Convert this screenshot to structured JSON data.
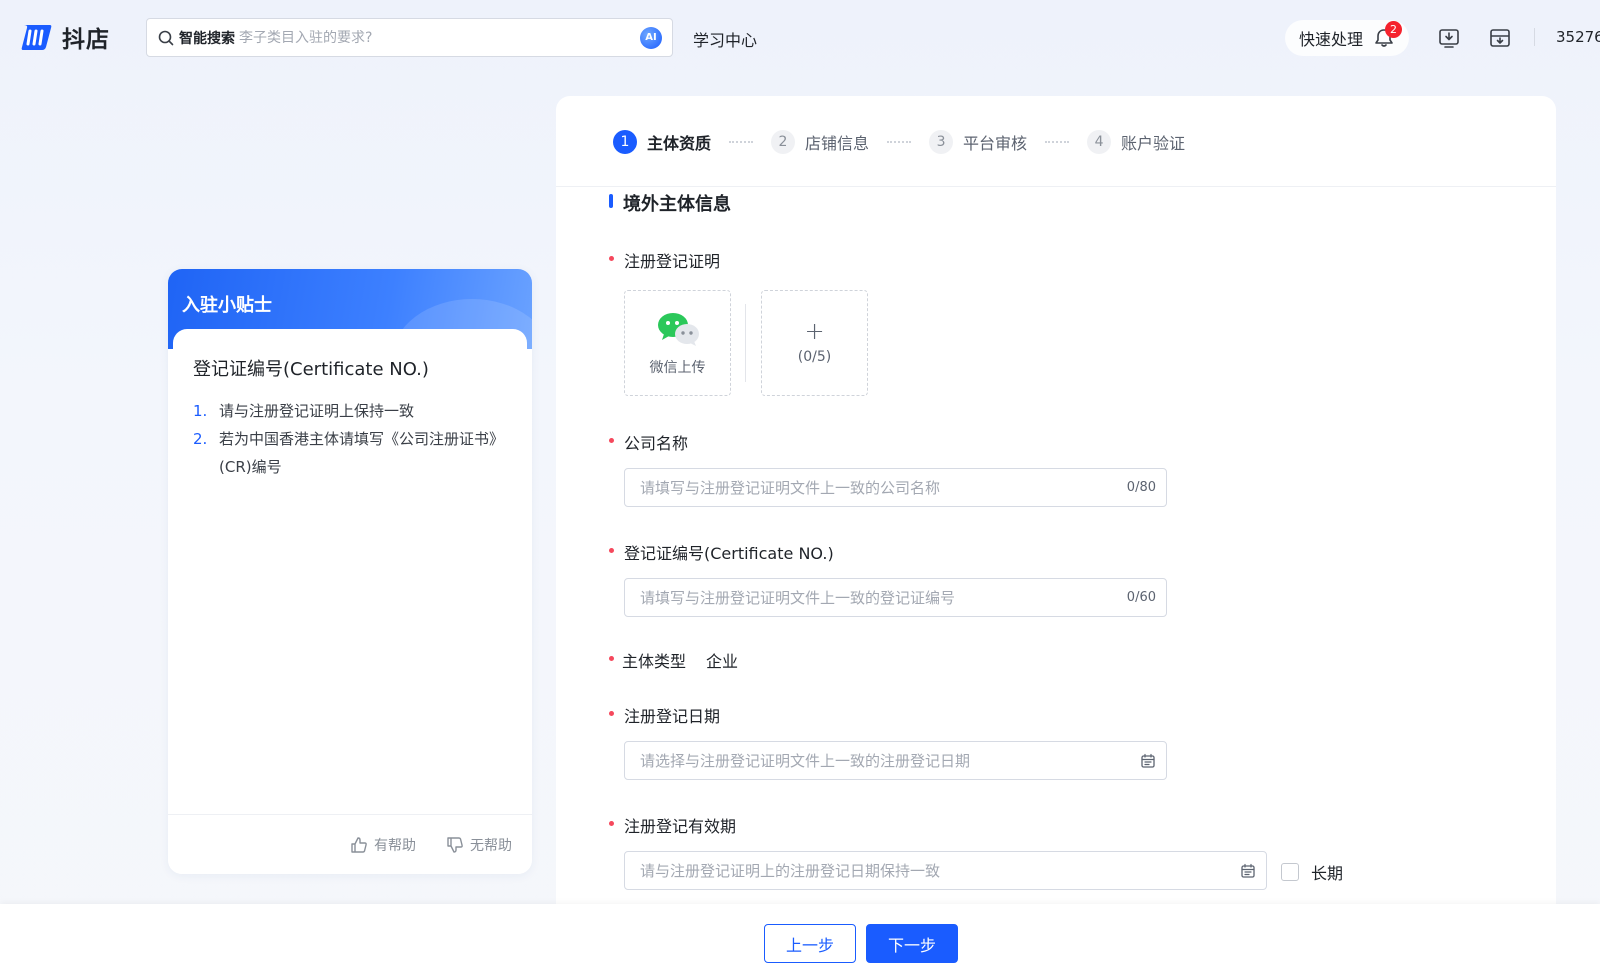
{
  "brand": {
    "name": "抖店",
    "accent": "#1a5cff"
  },
  "header": {
    "search_label": "智能搜索",
    "search_placeholder": "李子类目入驻的要求?",
    "ai_badge": "AI",
    "learning_center": "学习中心",
    "quick_process": "快速处理",
    "notification_count": "2",
    "account_id": "35276"
  },
  "tips": {
    "header": "入驻小贴士",
    "title": "登记证编号(Certificate NO.)",
    "items": [
      {
        "num": "1.",
        "text": "请与注册登记证明上保持一致"
      },
      {
        "num": "2.",
        "text": "若为中国香港主体请填写《公司注册证书》(CR)编号"
      }
    ],
    "helpful": "有帮助",
    "not_helpful": "无帮助"
  },
  "steps": [
    {
      "num": "1",
      "label": "主体资质",
      "active": true
    },
    {
      "num": "2",
      "label": "店铺信息",
      "active": false
    },
    {
      "num": "3",
      "label": "平台审核",
      "active": false
    },
    {
      "num": "4",
      "label": "账户验证",
      "active": false
    }
  ],
  "form": {
    "section_title": "境外主体信息",
    "registration_cert": {
      "label": "注册登记证明",
      "wechat_upload": "微信上传",
      "upload_count": "(0/5)"
    },
    "company_name": {
      "label": "公司名称",
      "placeholder": "请填写与注册登记证明文件上一致的公司名称",
      "counter": "0/80"
    },
    "certificate_no": {
      "label": "登记证编号(Certificate NO.)",
      "placeholder": "请填写与注册登记证明文件上一致的登记证编号",
      "counter": "0/60"
    },
    "entity_type": {
      "label": "主体类型",
      "value": "企业"
    },
    "registration_date": {
      "label": "注册登记日期",
      "placeholder": "请选择与注册登记证明文件上一致的注册登记日期"
    },
    "validity_period": {
      "label": "注册登记有效期",
      "placeholder": "请与注册登记证明上的注册登记日期保持一致",
      "long_term": "长期"
    }
  },
  "actions": {
    "prev": "上一步",
    "next": "下一步"
  }
}
